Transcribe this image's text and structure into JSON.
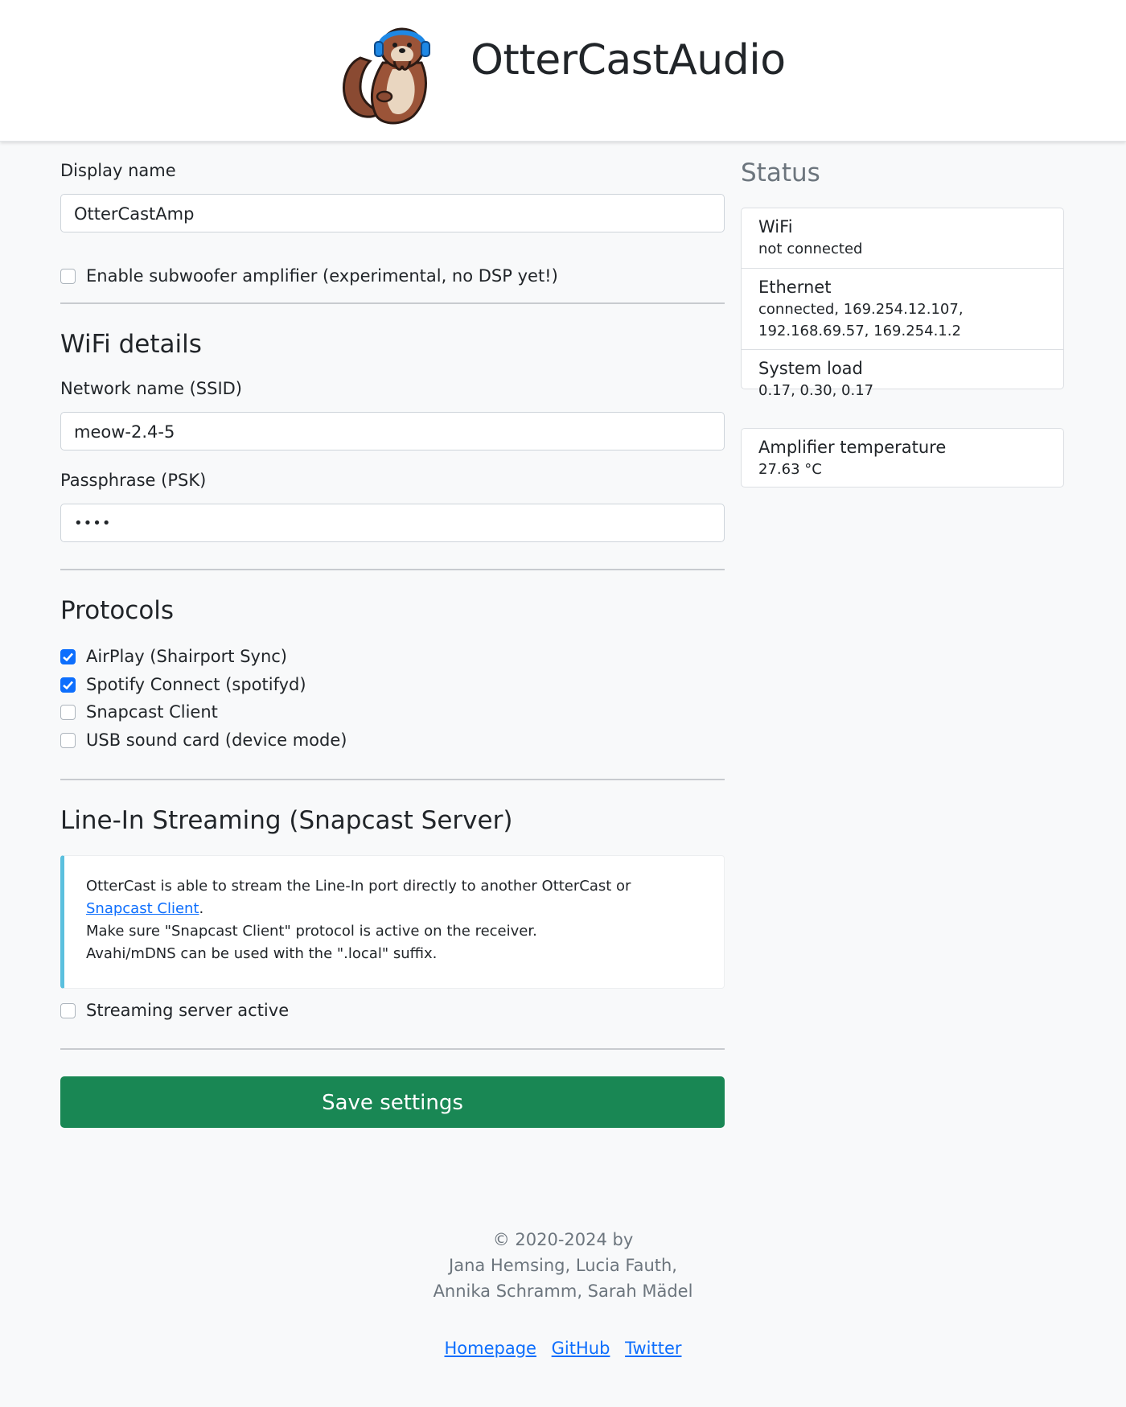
{
  "header": {
    "app_title": "OtterCastAudio",
    "logo_icon": "otter-with-headphones-logo"
  },
  "settings": {
    "display_name_label": "Display name",
    "display_name_value": "OtterCastAmp",
    "subwoofer_label": "Enable subwoofer amplifier (experimental, no DSP yet!)",
    "subwoofer_checked": false
  },
  "wifi": {
    "heading": "WiFi details",
    "ssid_label": "Network name (SSID)",
    "ssid_value": "meow-2.4-5",
    "psk_label": "Passphrase (PSK)",
    "psk_value": "••••"
  },
  "protocols": {
    "heading": "Protocols",
    "items": [
      {
        "label": "AirPlay (Shairport Sync)",
        "checked": true
      },
      {
        "label": "Spotify Connect (spotifyd)",
        "checked": true
      },
      {
        "label": "Snapcast Client",
        "checked": false
      },
      {
        "label": "USB sound card (device mode)",
        "checked": false
      }
    ]
  },
  "line_in": {
    "heading": "Line-In Streaming (Snapcast Server)",
    "info_text_1": "OtterCast is able to stream the Line-In port directly to another OtterCast or ",
    "info_link": "Snapcast Client",
    "info_text_1_end": ".",
    "info_text_2": "Make sure \"Snapcast Client\" protocol is active on the receiver.",
    "info_text_3": "Avahi/mDNS can be used with the \".local\" suffix.",
    "server_label": "Streaming server active",
    "server_checked": false
  },
  "save_button": "Save settings",
  "status": {
    "title": "Status",
    "wifi_label": "WiFi",
    "wifi_value": "not connected",
    "ethernet_label": "Ethernet",
    "ethernet_value_1": "connected, 169.254.12.107,",
    "ethernet_value_2": "192.168.69.57, 169.254.1.2",
    "load_label": "System load",
    "load_value": "0.17, 0.30, 0.17",
    "amp_temp_label": "Amplifier temperature",
    "amp_temp_value": "27.63 °C"
  },
  "footer": {
    "copyright": "© 2020-2024 by",
    "authors_1": "Jana Hemsing, Lucia Fauth,",
    "authors_2": "Annika Schramm, Sarah Mädel",
    "links": [
      "Homepage",
      "GitHub",
      "Twitter"
    ]
  },
  "colors": {
    "primary": "#0d6efd",
    "success": "#198754",
    "info": "#5bc0de",
    "muted": "#6c757d",
    "background": "#f8f9fa"
  }
}
